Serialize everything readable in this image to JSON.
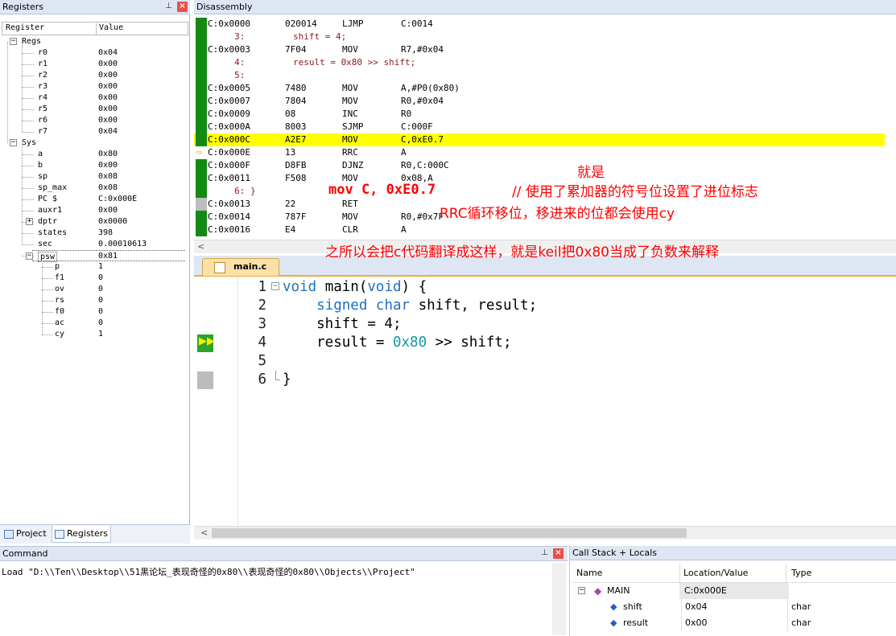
{
  "registers_panel": {
    "title": "Registers",
    "col_register": "Register",
    "col_value": "Value",
    "groups": [
      {
        "name": "Regs",
        "expander": "−",
        "items": [
          {
            "name": "r0",
            "value": "0x04"
          },
          {
            "name": "r1",
            "value": "0x00"
          },
          {
            "name": "r2",
            "value": "0x00"
          },
          {
            "name": "r3",
            "value": "0x00"
          },
          {
            "name": "r4",
            "value": "0x00"
          },
          {
            "name": "r5",
            "value": "0x00"
          },
          {
            "name": "r6",
            "value": "0x00"
          },
          {
            "name": "r7",
            "value": "0x04"
          }
        ]
      },
      {
        "name": "Sys",
        "expander": "−",
        "items": [
          {
            "name": "a",
            "value": "0x80"
          },
          {
            "name": "b",
            "value": "0x00"
          },
          {
            "name": "sp",
            "value": "0x08"
          },
          {
            "name": "sp_max",
            "value": "0x08"
          },
          {
            "name": "PC  $",
            "value": "C:0x000E"
          },
          {
            "name": "auxr1",
            "value": "0x00"
          },
          {
            "name": "dptr",
            "value": "0x0000",
            "expander": "+"
          },
          {
            "name": "states",
            "value": "398"
          },
          {
            "name": "sec",
            "value": "0.00010613"
          },
          {
            "name": "psw",
            "value": "0x81",
            "expander": "−"
          }
        ]
      }
    ],
    "psw_flags": [
      {
        "name": "p",
        "value": "1"
      },
      {
        "name": "f1",
        "value": "0"
      },
      {
        "name": "ov",
        "value": "0"
      },
      {
        "name": "rs",
        "value": "0"
      },
      {
        "name": "f0",
        "value": "0"
      },
      {
        "name": "ac",
        "value": "0"
      },
      {
        "name": "cy",
        "value": "1"
      }
    ],
    "tabs": [
      {
        "label": "Project"
      },
      {
        "label": "Registers"
      }
    ]
  },
  "disassembly": {
    "title": "Disassembly",
    "lines": [
      {
        "type": "asm",
        "addr": "C:0x0000",
        "opcode": "020014",
        "mnemonic": "LJMP",
        "args": "C:0014",
        "marker": "green"
      },
      {
        "type": "src",
        "text": "     3:         shift = 4;",
        "marker": "green"
      },
      {
        "type": "asm",
        "addr": "C:0x0003",
        "opcode": "7F04",
        "mnemonic": "MOV",
        "args": "R7,#0x04",
        "marker": "green"
      },
      {
        "type": "src",
        "text": "     4:         result = 0x80 >> shift;",
        "marker": "green"
      },
      {
        "type": "src",
        "text": "     5: ",
        "marker": "green"
      },
      {
        "type": "asm",
        "addr": "C:0x0005",
        "opcode": "7480",
        "mnemonic": "MOV",
        "args": "A,#P0(0x80)",
        "marker": "green"
      },
      {
        "type": "asm",
        "addr": "C:0x0007",
        "opcode": "7804",
        "mnemonic": "MOV",
        "args": "R0,#0x04",
        "marker": "green"
      },
      {
        "type": "asm",
        "addr": "C:0x0009",
        "opcode": "08",
        "mnemonic": "INC",
        "args": "R0",
        "marker": "green"
      },
      {
        "type": "asm",
        "addr": "C:0x000A",
        "opcode": "8003",
        "mnemonic": "SJMP",
        "args": "C:000F",
        "marker": "green"
      },
      {
        "type": "asm",
        "addr": "C:0x000C",
        "opcode": "A2E7",
        "mnemonic": "MOV",
        "args": "C,0xE0.7",
        "marker": "green",
        "highlight": true
      },
      {
        "type": "asm",
        "addr": "C:0x000E",
        "opcode": "13",
        "mnemonic": "RRC",
        "args": "A",
        "marker": "arrow"
      },
      {
        "type": "asm",
        "addr": "C:0x000F",
        "opcode": "D8FB",
        "mnemonic": "DJNZ",
        "args": "R0,C:000C",
        "marker": "green"
      },
      {
        "type": "asm",
        "addr": "C:0x0011",
        "opcode": "F508",
        "mnemonic": "MOV",
        "args": "0x08,A",
        "marker": "green"
      },
      {
        "type": "src",
        "text": "     6: }",
        "marker": "green"
      },
      {
        "type": "asm",
        "addr": "C:0x0013",
        "opcode": "22",
        "mnemonic": "RET",
        "args": "",
        "marker": "gray"
      },
      {
        "type": "asm",
        "addr": "C:0x0014",
        "opcode": "787F",
        "mnemonic": "MOV",
        "args": "R0,#0x7F",
        "marker": "green"
      },
      {
        "type": "asm",
        "addr": "C:0x0016",
        "opcode": "E4",
        "mnemonic": "CLR",
        "args": "A",
        "marker": "green"
      }
    ]
  },
  "editor": {
    "tab_label": "main.c",
    "lines": [
      {
        "num": "1",
        "parts": [
          {
            "t": "void",
            "c": "kw"
          },
          {
            "t": " main(",
            "c": ""
          },
          {
            "t": "void",
            "c": "kw"
          },
          {
            "t": ") {",
            "c": ""
          }
        ]
      },
      {
        "num": "2",
        "parts": [
          {
            "t": "    ",
            "c": ""
          },
          {
            "t": "signed",
            "c": "kw"
          },
          {
            "t": " ",
            "c": ""
          },
          {
            "t": "char",
            "c": "kw"
          },
          {
            "t": " shift, result;",
            "c": ""
          }
        ]
      },
      {
        "num": "3",
        "parts": [
          {
            "t": "    shift = 4;",
            "c": ""
          }
        ]
      },
      {
        "num": "4",
        "parts": [
          {
            "t": "    result = ",
            "c": ""
          },
          {
            "t": "0x80",
            "c": "num"
          },
          {
            "t": " >> shift;",
            "c": ""
          }
        ]
      },
      {
        "num": "5",
        "parts": [
          {
            "t": "",
            "c": ""
          }
        ]
      },
      {
        "num": "6",
        "parts": [
          {
            "t": "}",
            "c": ""
          }
        ]
      }
    ]
  },
  "annotations": {
    "a1": "就是",
    "a2": "mov C, 0xE0.7",
    "a3": "// 使用了累加器的符号位设置了进位标志",
    "a4": "RRC循环移位，移进来的位都会使用cy",
    "a5": "之所以会把c代码翻译成这样，就是keil把0x80当成了负数来解释"
  },
  "command": {
    "title": "Command",
    "text": "Load \"D:\\\\Ten\\\\Desktop\\\\51黑论坛_表现奇怪的0x80\\\\表现奇怪的0x80\\\\Objects\\\\Project\""
  },
  "callstack": {
    "title": "Call Stack + Locals",
    "col_name": "Name",
    "col_location": "Location/Value",
    "col_type": "Type",
    "rows": [
      {
        "name": "MAIN",
        "value": "C:0x000E",
        "type": ""
      },
      {
        "name": "shift",
        "value": "0x04",
        "type": "char"
      },
      {
        "name": "result",
        "value": "0x00",
        "type": "char"
      }
    ]
  },
  "colors": {
    "marker_green": "#138a13",
    "highlight": "#ffff00",
    "annotation": "#ff0000"
  }
}
